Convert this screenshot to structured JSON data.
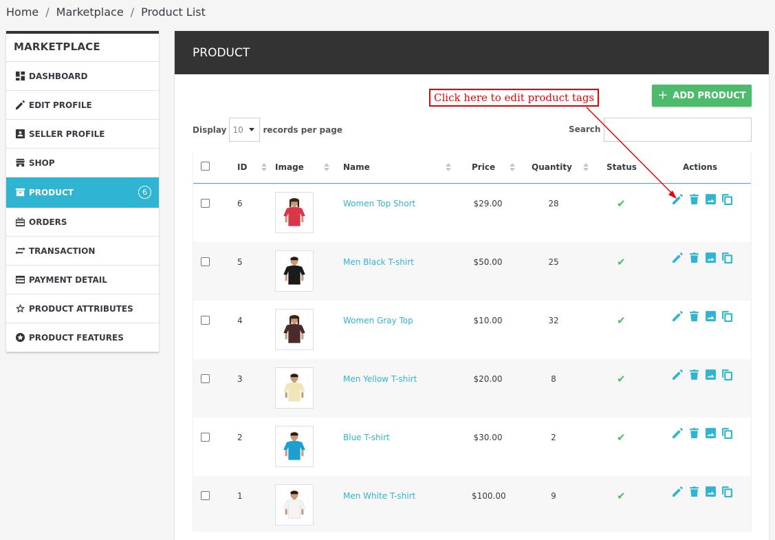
{
  "breadcrumb": [
    "Home",
    "Marketplace",
    "Product List"
  ],
  "sidebar": {
    "title": "MARKETPLACE",
    "items": [
      {
        "label": "DASHBOARD",
        "icon": "dashboard-icon"
      },
      {
        "label": "EDIT PROFILE",
        "icon": "pencil-icon"
      },
      {
        "label": "SELLER PROFILE",
        "icon": "contact-card-icon"
      },
      {
        "label": "SHOP",
        "icon": "store-icon"
      },
      {
        "label": "PRODUCT",
        "icon": "archive-box-icon",
        "badge": "6",
        "active": true
      },
      {
        "label": "ORDERS",
        "icon": "gift-card-icon"
      },
      {
        "label": "TRANSACTION",
        "icon": "swap-arrows-icon"
      },
      {
        "label": "PAYMENT DETAIL",
        "icon": "credit-card-icon"
      },
      {
        "label": "PRODUCT ATTRIBUTES",
        "icon": "star-outline-icon"
      },
      {
        "label": "PRODUCT FEATURES",
        "icon": "star-circle-icon"
      }
    ]
  },
  "panel": {
    "title": "PRODUCT",
    "add_button": "ADD PRODUCT",
    "display_label": "Display",
    "per_page": "10",
    "records_label": "records per page",
    "search_label": "Search",
    "search_value": ""
  },
  "table": {
    "headers": {
      "id": "ID",
      "image": "Image",
      "name": "Name",
      "price": "Price",
      "quantity": "Quantity",
      "status": "Status",
      "actions": "Actions"
    },
    "rows": [
      {
        "id": "6",
        "name": "Women Top Short",
        "price": "$29.00",
        "quantity": "28",
        "shirt_color": "#d9364a",
        "model": "woman"
      },
      {
        "id": "5",
        "name": "Men Black T-shirt",
        "price": "$50.00",
        "quantity": "25",
        "shirt_color": "#1b1b1b",
        "model": "man"
      },
      {
        "id": "4",
        "name": "Women Gray Top",
        "price": "$10.00",
        "quantity": "32",
        "shirt_color": "#4a2a2a",
        "model": "woman"
      },
      {
        "id": "3",
        "name": "Men Yellow T-shirt",
        "price": "$20.00",
        "quantity": "8",
        "shirt_color": "#f1e6b8",
        "model": "man"
      },
      {
        "id": "2",
        "name": "Blue T-shirt",
        "price": "$30.00",
        "quantity": "2",
        "shirt_color": "#1ea0cf",
        "model": "man"
      },
      {
        "id": "1",
        "name": "Men White T-shirt",
        "price": "$100.00",
        "quantity": "9",
        "shirt_color": "#f4f4f4",
        "model": "man"
      }
    ]
  },
  "annotation": {
    "text": "Click here to edit product tags",
    "color": "#e00000"
  },
  "colors": {
    "accent": "#2fb5d2",
    "success": "#4cbb6c",
    "header_dark": "#333333"
  }
}
